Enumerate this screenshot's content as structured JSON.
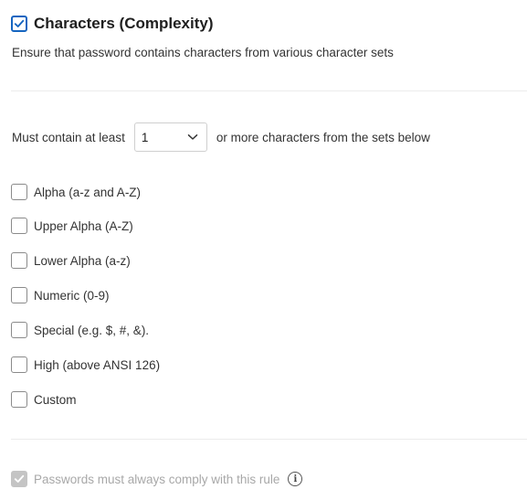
{
  "header": {
    "checked": true,
    "title": "Characters (Complexity)"
  },
  "description": "Ensure that password contains characters from various character sets",
  "minimum": {
    "prefix": "Must contain at least",
    "selected_value": "1",
    "suffix": "or more characters from the sets below"
  },
  "character_sets": [
    {
      "label": "Alpha (a-z and A-Z)",
      "checked": false
    },
    {
      "label": "Upper Alpha (A-Z)",
      "checked": false
    },
    {
      "label": "Lower Alpha (a-z)",
      "checked": false
    },
    {
      "label": "Numeric (0-9)",
      "checked": false
    },
    {
      "label": "Special (e.g. $, #, &).",
      "checked": false
    },
    {
      "label": "High (above ANSI 126)",
      "checked": false
    },
    {
      "label": "Custom",
      "checked": false
    }
  ],
  "footer": {
    "label": "Passwords must always comply with this rule",
    "checked": true,
    "disabled": true,
    "info_icon": "info-icon"
  },
  "colors": {
    "accent": "#1565c0",
    "text": "#333333",
    "disabled_text": "#a8a8a8",
    "disabled_checkbox": "#c4c4c4",
    "divider": "#ececec"
  }
}
